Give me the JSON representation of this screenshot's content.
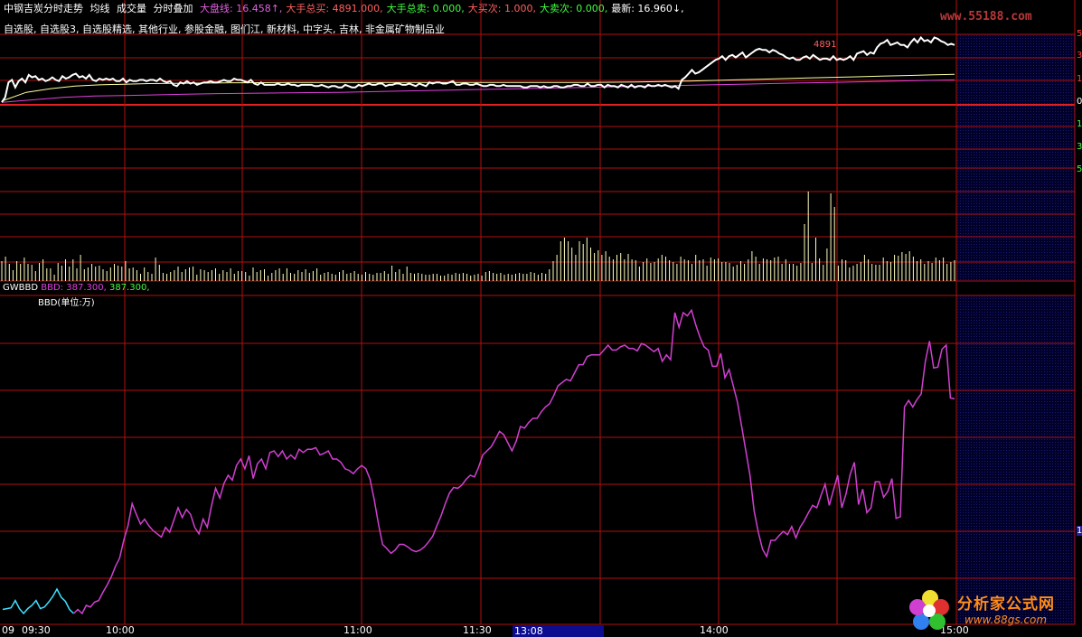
{
  "header": {
    "title": "中钢吉炭分时走势",
    "tags": [
      "均线",
      "成交量",
      "分时叠加"
    ],
    "stats": [
      {
        "label": "大盘线",
        "value": "16.458↑",
        "color": "#e060e0"
      },
      {
        "label": "大手总买",
        "value": "4891.000",
        "color": "#ff6060"
      },
      {
        "label": "大手总卖",
        "value": "0.000",
        "color": "#40ff40"
      },
      {
        "label": "大买次",
        "value": "1.000",
        "color": "#ff6060"
      },
      {
        "label": "大卖次",
        "value": "0.000",
        "color": "#40ff40"
      },
      {
        "label": "最新",
        "value": "16.960↓",
        "color": "#ffffff"
      }
    ]
  },
  "blocks": "自选股, 自选股3, 自选股精选, 其他行业, 参股金融, 图们江, 新材料, 中字头, 吉林, 非金属矿物制品业",
  "price_annotation": "4891",
  "right_labels": [
    "5",
    "3",
    "1",
    "0",
    "1",
    "3",
    "5"
  ],
  "indicator": {
    "name": "GWBBD",
    "line_label": "BBD",
    "value1": "387.300",
    "value2": "387.300,",
    "unit": "BBD(单位:万)",
    "right_label": "1"
  },
  "time_axis": {
    "ticks": [
      "09",
      "09:30",
      "10:00",
      "11:00",
      "11:30",
      "14:00",
      "15:00"
    ],
    "cursor": "13:08"
  },
  "watermark": "www.55188.com",
  "logo": {
    "title": "分析家公式网",
    "url": "www.88gs.com"
  },
  "colors": {
    "grid": "#b01010",
    "price": "#ffffff",
    "avg": "#ffffa0",
    "index": "#e040e0",
    "volume": "#ffffc0",
    "bbd": "#d040d0"
  },
  "chart_data": [
    {
      "type": "line",
      "name": "intraday-price",
      "series": [
        {
          "name": "price",
          "values": [
            0.2,
            0.6,
            1.8,
            2.0,
            1.4,
            1.9,
            2.1,
            1.8,
            2.4,
            2.2,
            2.3,
            2.0,
            2.1,
            1.9,
            2.0,
            2.2,
            2.0,
            1.9,
            2.3,
            2.1,
            2.2,
            2.4,
            2.5,
            2.2,
            2.3,
            2.1,
            2.4,
            2.0,
            1.9,
            2.1,
            2.0,
            2.1,
            2.0,
            2.1,
            1.9,
            1.9,
            2.1,
            1.8,
            2.0,
            1.9,
            1.9,
            2.0,
            2.0,
            1.9,
            2.0,
            2.0,
            1.9,
            2.1,
            1.9,
            1.8,
            1.9,
            1.6,
            1.5,
            1.8,
            1.7,
            1.9,
            1.7,
            1.8,
            1.6,
            1.7,
            1.8,
            1.8,
            1.9,
            1.8,
            1.8,
            1.9,
            2.0,
            1.9,
            1.9,
            2.1,
            2.0,
            2.0,
            1.9,
            1.8,
            2.0,
            1.7,
            1.6,
            1.8,
            1.6,
            1.6,
            1.6,
            1.6,
            1.7,
            1.6,
            1.6,
            1.7,
            1.6,
            1.6,
            1.5,
            1.6,
            1.6,
            1.6,
            1.6,
            1.5,
            1.5,
            1.6,
            1.5,
            1.4,
            1.5,
            1.5,
            1.4,
            1.4,
            1.6,
            1.5,
            1.4,
            1.4,
            1.6,
            1.5,
            1.6,
            1.7,
            1.6,
            1.6,
            1.7,
            1.7,
            1.5,
            1.6,
            1.6,
            1.7,
            1.7,
            1.6,
            1.6,
            1.7,
            1.6,
            1.5,
            1.7,
            1.6,
            1.5,
            1.8,
            1.7,
            1.8,
            1.8,
            1.7,
            1.7,
            1.8,
            1.9,
            1.6,
            1.6,
            1.7,
            1.7,
            1.6,
            1.6,
            1.7,
            1.6,
            1.5,
            1.5,
            1.6,
            1.6,
            1.5,
            1.5,
            1.6,
            1.5,
            1.5,
            1.5,
            1.5,
            1.5,
            1.4,
            1.4,
            1.5,
            1.5,
            1.5,
            1.4,
            1.5,
            1.4,
            1.4,
            1.5,
            1.5,
            1.4,
            1.4,
            1.5,
            1.5,
            1.6,
            1.6,
            1.5,
            1.5,
            1.7,
            1.5,
            1.5,
            1.6,
            1.6,
            1.4,
            1.6,
            1.5,
            1.5,
            1.4,
            1.6,
            1.5,
            1.4,
            1.6,
            1.4,
            1.5,
            1.5,
            1.4,
            1.6,
            1.5,
            1.5,
            1.6,
            1.5,
            1.6,
            1.5,
            1.4,
            1.5,
            1.3,
            2.0,
            2.2,
            2.5,
            2.8,
            2.5,
            2.6,
            2.8,
            3.0,
            3.2,
            3.4,
            3.6,
            3.7,
            3.9,
            3.6,
            3.9,
            4.0,
            3.8,
            4.0,
            4.2,
            3.8,
            4.0,
            4.2,
            4.4,
            4.5,
            4.4,
            4.4,
            4.2,
            4.4,
            4.3,
            4.1,
            4.0,
            3.8,
            3.7,
            3.8,
            3.6,
            3.6,
            3.8,
            3.9,
            3.7,
            4.0,
            3.8,
            3.6,
            3.7,
            3.7,
            3.6,
            3.9,
            3.6,
            3.7,
            3.6,
            3.7,
            3.9,
            3.6,
            4.1,
            4.2,
            4.3,
            4.0,
            4.2,
            4.1,
            4.6,
            4.9,
            5.0,
            5.2,
            4.8,
            4.9,
            5.0,
            4.8,
            4.8,
            4.6,
            5.0,
            5.3,
            5.0,
            5.4,
            5.1,
            5.2,
            5.0,
            5.4,
            5.3,
            5.1,
            5.0,
            4.8,
            4.9,
            4.8
          ]
        },
        {
          "name": "average",
          "values": [
            0.3,
            1.0,
            1.3,
            1.5,
            1.6,
            1.65,
            1.7,
            1.72,
            1.74,
            1.76,
            1.77,
            1.78,
            1.79,
            1.8,
            1.8,
            1.8,
            1.8,
            1.8,
            1.8,
            1.8,
            1.79,
            1.79,
            1.79,
            1.79,
            1.8,
            1.81,
            1.83,
            1.86,
            1.9,
            1.95,
            2.0,
            2.05,
            2.1,
            2.15,
            2.2,
            2.25,
            2.3,
            2.35,
            2.4,
            2.45
          ]
        },
        {
          "name": "index",
          "values": [
            0.2,
            0.4,
            0.6,
            0.7,
            0.75,
            0.8,
            0.85,
            0.9,
            0.92,
            0.95,
            0.98,
            1.0,
            1.05,
            1.1,
            1.15,
            1.2,
            1.25,
            1.3,
            1.35,
            1.4,
            1.45,
            1.5,
            1.55,
            1.6,
            1.65,
            1.7,
            1.75,
            1.8,
            1.85,
            1.9,
            1.95,
            2.0
          ]
        }
      ],
      "ylim": [
        -5.5,
        5.5
      ]
    },
    {
      "type": "bar",
      "name": "volume",
      "values": [
        22,
        27,
        19,
        12,
        22,
        19,
        26,
        19,
        18,
        11,
        20,
        24,
        14,
        14,
        7,
        20,
        17,
        24,
        16,
        24,
        14,
        29,
        13,
        15,
        19,
        16,
        17,
        13,
        11,
        15,
        19,
        17,
        16,
        22,
        14,
        15,
        12,
        8,
        15,
        10,
        8,
        26,
        18,
        9,
        8,
        10,
        12,
        16,
        10,
        13,
        15,
        16,
        7,
        13,
        12,
        10,
        12,
        14,
        8,
        12,
        10,
        14,
        8,
        11,
        11,
        10,
        6,
        15,
        10,
        12,
        13,
        6,
        9,
        12,
        14,
        8,
        14,
        9,
        8,
        12,
        10,
        13,
        9,
        11,
        14,
        7,
        9,
        10,
        8,
        7,
        10,
        12,
        8,
        9,
        11,
        8,
        7,
        10,
        8,
        7,
        9,
        9,
        11,
        8,
        17,
        10,
        13,
        8,
        16,
        9,
        8,
        9,
        8,
        7,
        7,
        8,
        8,
        6,
        6,
        8,
        7,
        9,
        8,
        9,
        8,
        6,
        7,
        8,
        6,
        10,
        11,
        9,
        8,
        9,
        7,
        8,
        7,
        8,
        9,
        8,
        8,
        10,
        9,
        7,
        9,
        8,
        13,
        22,
        29,
        44,
        48,
        44,
        37,
        29,
        44,
        41,
        48,
        37,
        31,
        34,
        29,
        33,
        27,
        24,
        29,
        31,
        24,
        30,
        24,
        23,
        16,
        21,
        25,
        20,
        21,
        25,
        29,
        27,
        23,
        21,
        19,
        27,
        24,
        23,
        19,
        29,
        23,
        24,
        17,
        26,
        24,
        25,
        21,
        21,
        20,
        16,
        18,
        22,
        19,
        24,
        33,
        27,
        19,
        25,
        24,
        23,
        26,
        27,
        19,
        24,
        19,
        19,
        17,
        20,
        63,
        99,
        20,
        48,
        25,
        18,
        36,
        97,
        82,
        17,
        24,
        23,
        15,
        17,
        19,
        21,
        29,
        24,
        19,
        18,
        18,
        26,
        22,
        21,
        29,
        28,
        32,
        30,
        33,
        27,
        22,
        24,
        19,
        22,
        20,
        26,
        23,
        26,
        19,
        21,
        23
      ]
    },
    {
      "type": "line",
      "name": "GWBBD",
      "series": [
        {
          "name": "BBD",
          "values": [
            15,
            16,
            17,
            26,
            16,
            10,
            16,
            20,
            26,
            16,
            18,
            24,
            31,
            40,
            30,
            25,
            15,
            10,
            15,
            10,
            20,
            18,
            24,
            26,
            36,
            45,
            55,
            68,
            78,
            100,
            118,
            145,
            132,
            120,
            126,
            118,
            112,
            108,
            104,
            116,
            110,
            125,
            140,
            128,
            138,
            132,
            116,
            108,
            126,
            116,
            142,
            164,
            152,
            170,
            180,
            174,
            192,
            200,
            188,
            204,
            176,
            194,
            200,
            188,
            208,
            210,
            203,
            210,
            200,
            205,
            200,
            212,
            208,
            212,
            212,
            214,
            205,
            207,
            210,
            200,
            200,
            196,
            188,
            186,
            182,
            188,
            192,
            188,
            175,
            150,
            120,
            95,
            90,
            84,
            88,
            95,
            95,
            92,
            88,
            86,
            88,
            92,
            98,
            105,
            118,
            130,
            145,
            158,
            165,
            164,
            168,
            175,
            180,
            178,
            190,
            205,
            210,
            215,
            224,
            234,
            230,
            220,
            210,
            222,
            240,
            238,
            245,
            250,
            250,
            258,
            264,
            268,
            278,
            290,
            294,
            298,
            296,
            306,
            316,
            316,
            326,
            328,
            328,
            328,
            334,
            340,
            334,
            334,
            338,
            340,
            336,
            336,
            333,
            342,
            340,
            336,
            332,
            336,
            320,
            328,
            322,
            380,
            362,
            380,
            376,
            383,
            365,
            350,
            338,
            334,
            314,
            314,
            330,
            300,
            310,
            290,
            270,
            240,
            210,
            180,
            136,
            110,
            89,
            80,
            100,
            100,
            106,
            111,
            107,
            117,
            103,
            116,
            124,
            134,
            143,
            140,
            155,
            169,
            143,
            162,
            180,
            140,
            157,
            181,
            196,
            144,
            163,
            134,
            140,
            172,
            172,
            153,
            160,
            176,
            127,
            129,
            264,
            272,
            264,
            273,
            280,
            320,
            345,
            312,
            313,
            335,
            340,
            275,
            274
          ]
        }
      ],
      "ylim": [
        0,
        400
      ]
    }
  ]
}
